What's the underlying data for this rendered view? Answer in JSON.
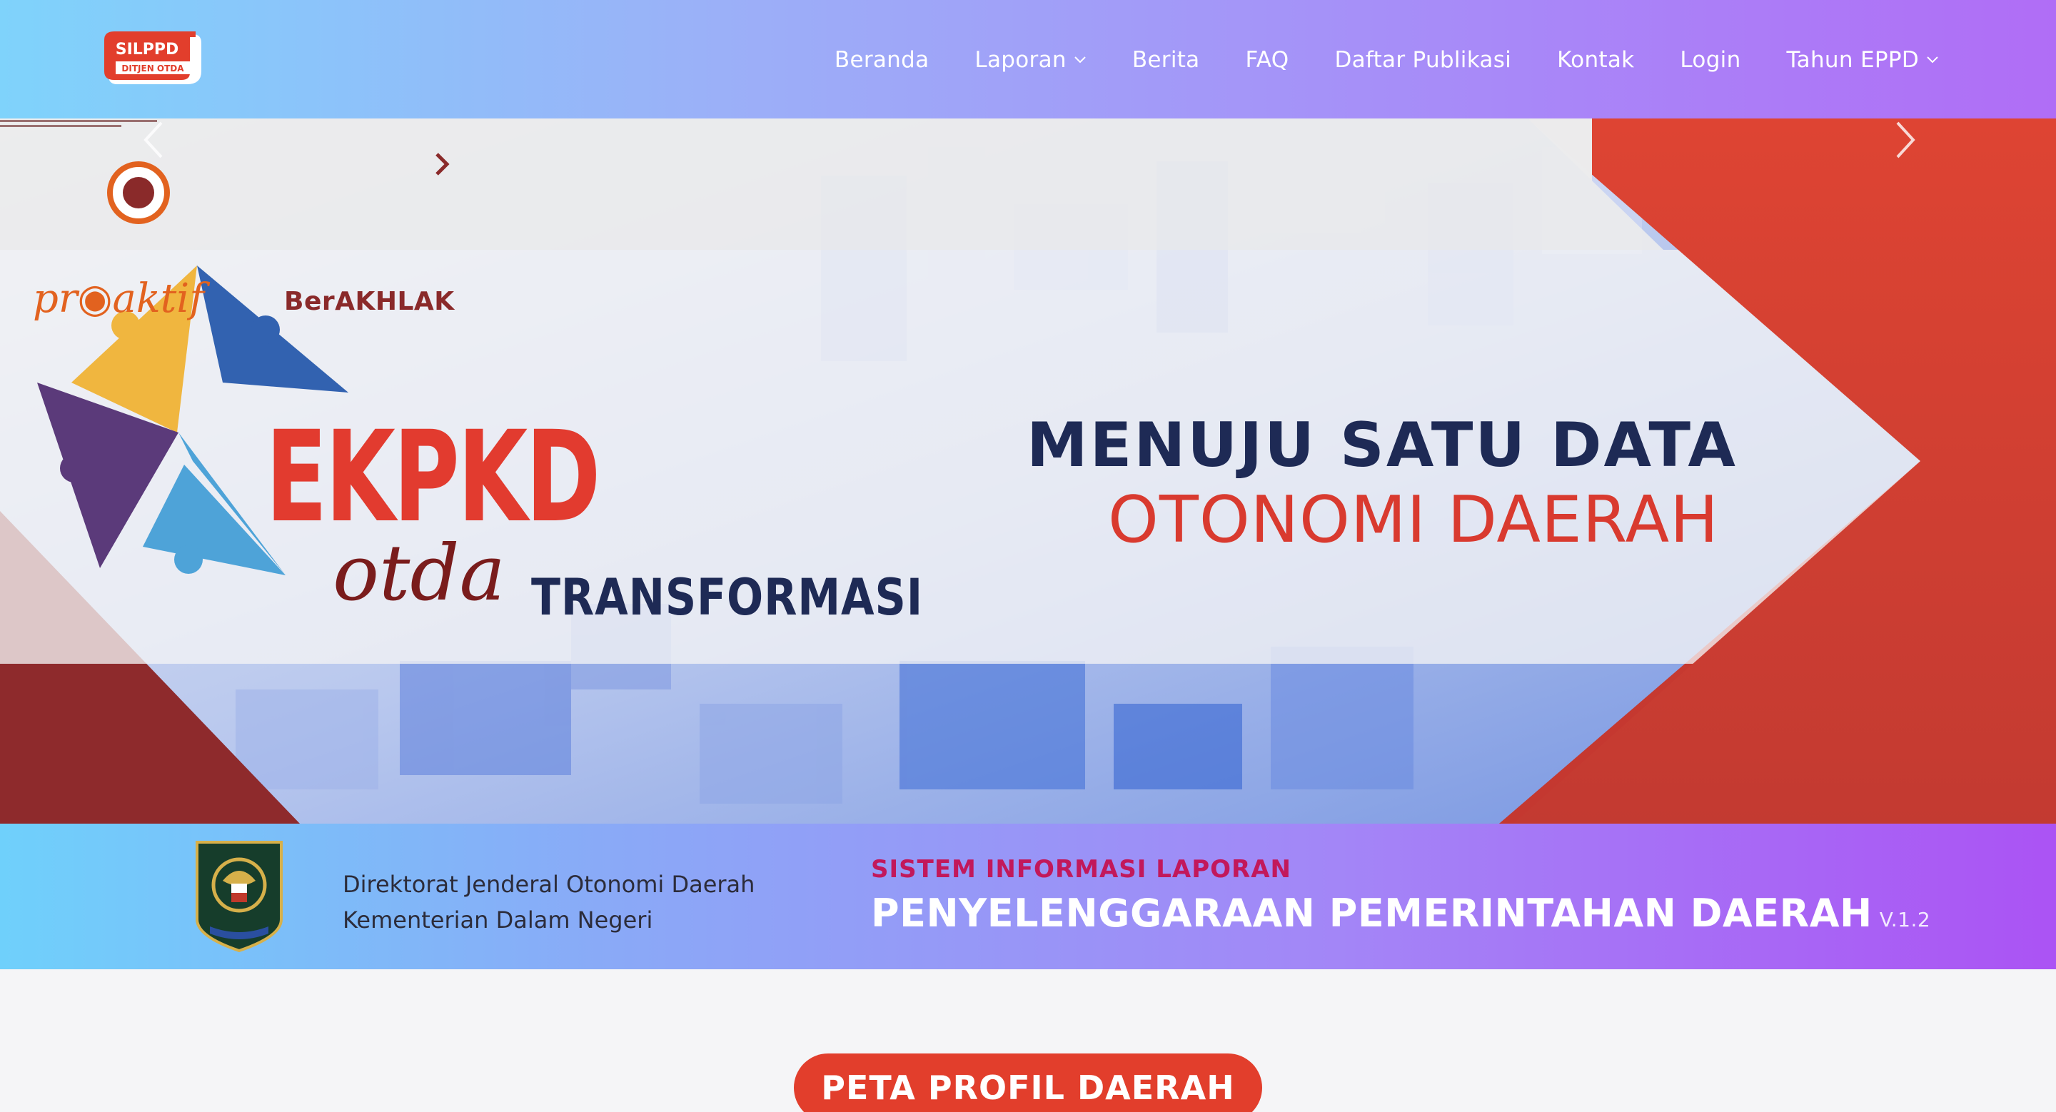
{
  "header": {
    "logo": {
      "line1": "SILPPD",
      "line2": "DITJEN OTDA"
    },
    "nav": [
      {
        "label": "Beranda",
        "dropdown": false
      },
      {
        "label": "Laporan",
        "dropdown": true
      },
      {
        "label": "Berita",
        "dropdown": false
      },
      {
        "label": "FAQ",
        "dropdown": false
      },
      {
        "label": "Daftar Publikasi",
        "dropdown": false
      },
      {
        "label": "Kontak",
        "dropdown": false
      },
      {
        "label": "Login",
        "dropdown": false
      },
      {
        "label": "Tahun EPPD",
        "dropdown": true
      }
    ]
  },
  "hero": {
    "proaktif": "pr◉aktif",
    "berakhlak": "BerAKHLAK",
    "ekpkd": "EKPKD",
    "otda": "otda",
    "transformasi": "TRANSFORMASI",
    "title_line1": "MENUJU SATU DATA",
    "title_line2": "OTONOMI DAERAH",
    "slides": 3,
    "active_slide": 2
  },
  "band": {
    "org_line1": "Direktorat Jenderal Otonomi Daerah",
    "org_line2": "Kementerian Dalam Negeri",
    "system_small": "SISTEM INFORMASI LAPORAN",
    "system_big": "PENYELENGGARAAN PEMERINTAHAN DAERAH",
    "version": "V.1.2"
  },
  "section": {
    "button": "PETA PROFIL DAERAH"
  },
  "colors": {
    "accent_red": "#e23e2c",
    "navy": "#1e2a55",
    "magenta": "#c2185b"
  }
}
